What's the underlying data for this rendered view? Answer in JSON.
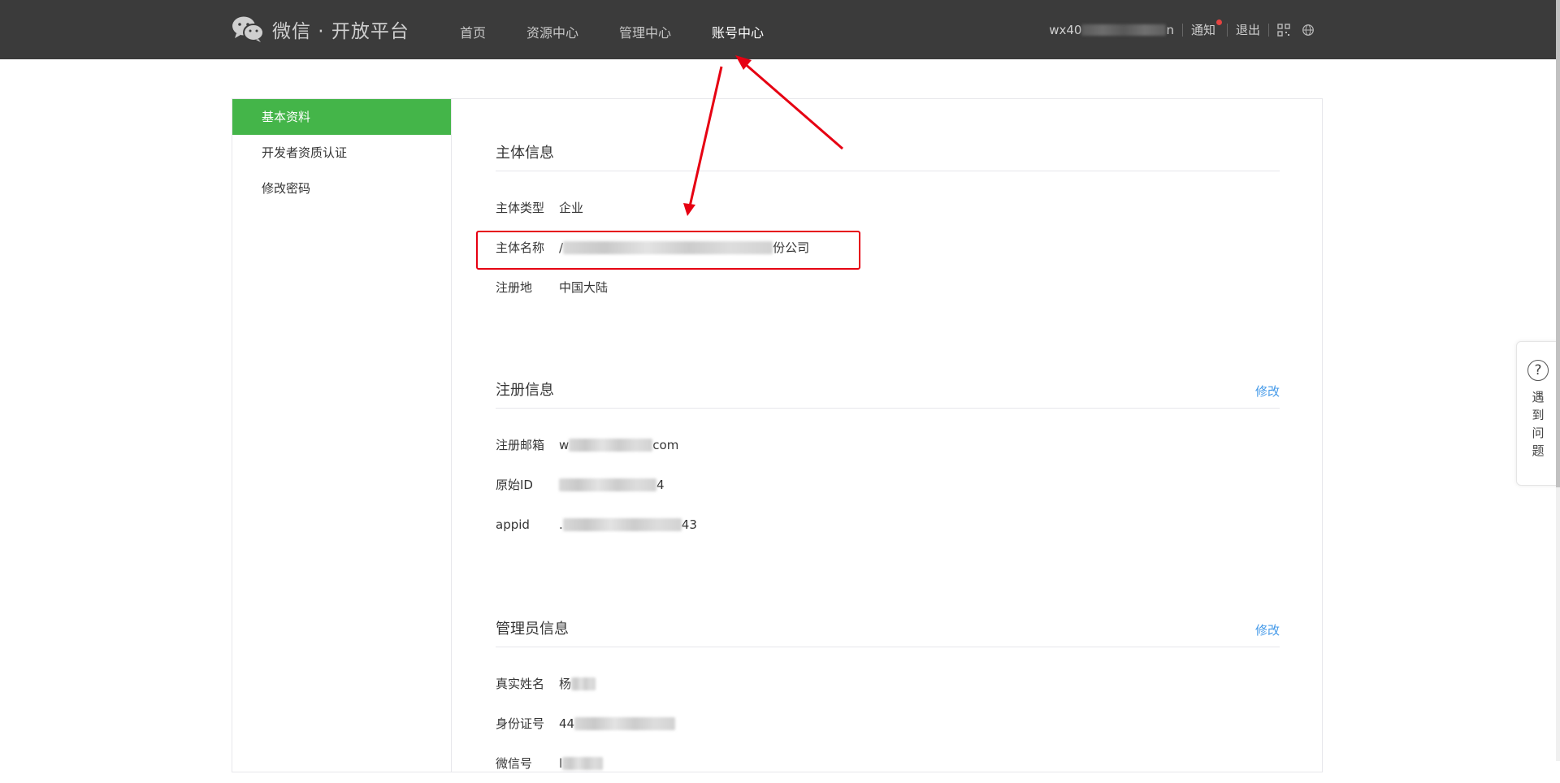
{
  "header": {
    "logo_text": "微信 · 开放平台",
    "nav": [
      {
        "label": "首页"
      },
      {
        "label": "资源中心"
      },
      {
        "label": "管理中心"
      },
      {
        "label": "账号中心",
        "active": true
      }
    ],
    "account_prefix": "wx40",
    "account_suffix": "n",
    "notify_label": "通知",
    "logout_label": "退出"
  },
  "sidebar": {
    "items": [
      {
        "label": "基本资料",
        "active": true
      },
      {
        "label": "开发者资质认证"
      },
      {
        "label": "修改密码"
      }
    ]
  },
  "entity": {
    "title": "主体信息",
    "rows": [
      {
        "label": "主体类型",
        "value": "企业"
      },
      {
        "label": "主体名称",
        "prefix": "/",
        "suffix": "份公司"
      },
      {
        "label": "注册地",
        "value": "中国大陆"
      }
    ]
  },
  "registration": {
    "title": "注册信息",
    "edit_label": "修改",
    "rows": [
      {
        "label": "注册邮箱",
        "prefix": "w",
        "suffix": "com"
      },
      {
        "label": "原始ID",
        "prefix": "",
        "suffix": "4"
      },
      {
        "label": "appid",
        "prefix": ".",
        "suffix": "43"
      }
    ]
  },
  "admin": {
    "title": "管理员信息",
    "edit_label": "修改",
    "rows": [
      {
        "label": "真实姓名",
        "prefix": "杨",
        "suffix": ""
      },
      {
        "label": "身份证号",
        "prefix": "44",
        "suffix": ""
      },
      {
        "label": "微信号",
        "prefix": "l",
        "suffix": ""
      }
    ]
  },
  "help": {
    "icon": "?",
    "label": "遇到问题"
  },
  "colors": {
    "topbar": "#3b3b3b",
    "active_green": "#44b549",
    "link_blue": "#459ae9",
    "annotation_red": "#e60012"
  }
}
